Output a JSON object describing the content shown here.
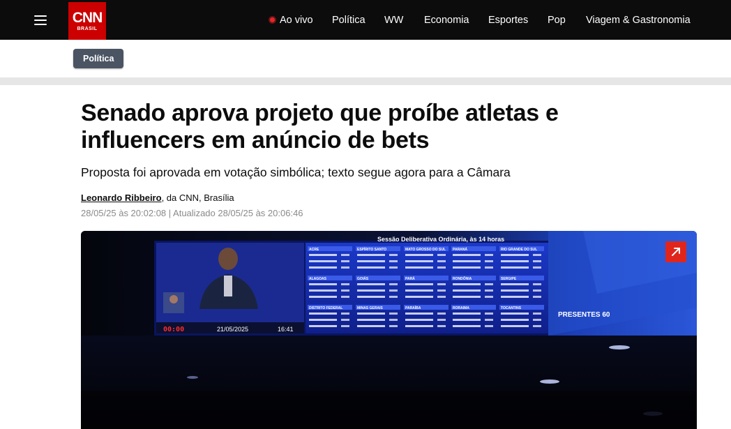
{
  "header": {
    "logo_main": "CNN",
    "logo_sub": "BRASIL",
    "nav": {
      "live": "Ao vivo",
      "politica": "Política",
      "ww": "WW",
      "economia": "Economia",
      "esportes": "Esportes",
      "pop": "Pop",
      "viagem": "Viagem & Gastronomia"
    }
  },
  "section_tag": "Política",
  "article": {
    "headline": "Senado aprova projeto que proíbe atletas e influencers em anúncio de bets",
    "subhead": "Proposta foi aprovada em votação simbólica; texto segue agora para a Câmara",
    "author": "Leonardo Ribbeiro",
    "byline_rest": ", da CNN, Brasília",
    "dates": "28/05/25 às 20:02:08 | Atualizado 28/05/25 às 20:06:46"
  },
  "photo_text": {
    "session_title": "Sessão Deliberativa Ordinária, às 14 horas",
    "presentes": "PRESENTES 60",
    "clock": "00:00",
    "date": "21/05/2025",
    "time": "16:41",
    "states": [
      "ACRE",
      "ALAGOAS",
      "DISTRITO FEDERAL",
      "ESPÍRITO SANTO",
      "GOIÁS",
      "MINAS GERAIS",
      "MATO GROSSO DO SUL",
      "PARÁ",
      "PARAÍBA",
      "PARANÁ",
      "RONDÔNIA",
      "RORAIMA",
      "RIO GRANDE DO SUL",
      "SERGIPE",
      "TOCANTINS"
    ]
  },
  "colors": {
    "topbar": "#0c0c0c",
    "brand_red": "#cc0000",
    "tag_bg": "#4a5463",
    "live_dot": "#e0262b",
    "expand_btn": "#e0261c"
  }
}
